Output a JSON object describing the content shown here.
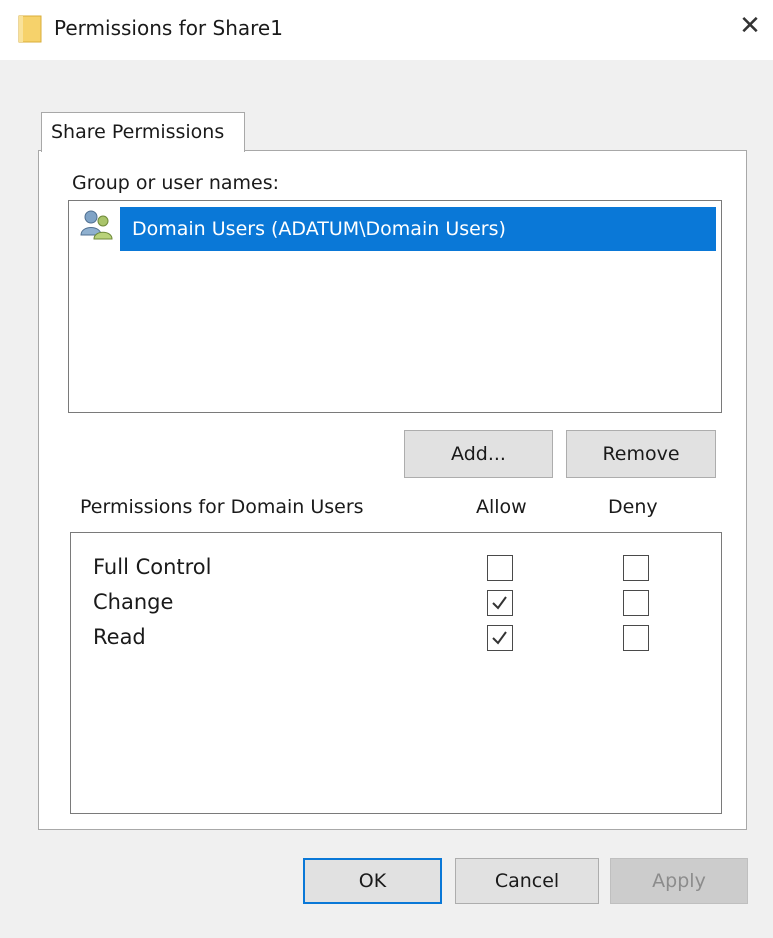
{
  "window": {
    "title": "Permissions for Share1",
    "close_label": "✕",
    "folder_icon": "folder-icon"
  },
  "tabs": [
    {
      "label": "Share Permissions",
      "selected": true
    }
  ],
  "group_section": {
    "label": "Group or user names:",
    "users": [
      {
        "name": "Domain Users (ADATUM\\Domain Users)",
        "icon": "users-group-icon",
        "selected": true
      }
    ]
  },
  "buttons": {
    "add_label": "Add...",
    "remove_label": "Remove"
  },
  "permissions": {
    "header_title": "Permissions for Domain Users",
    "allow_header": "Allow",
    "deny_header": "Deny",
    "rows": [
      {
        "name": "Full Control",
        "allow": false,
        "deny": false
      },
      {
        "name": "Change",
        "allow": true,
        "deny": false
      },
      {
        "name": "Read",
        "allow": true,
        "deny": false
      }
    ]
  },
  "footer": {
    "ok_label": "OK",
    "cancel_label": "Cancel",
    "apply_label": "Apply",
    "apply_enabled": false
  },
  "colors": {
    "selection": "#0a78d7",
    "dialog_bg": "#f0f0f0",
    "button_bg": "#e1e1e1"
  }
}
